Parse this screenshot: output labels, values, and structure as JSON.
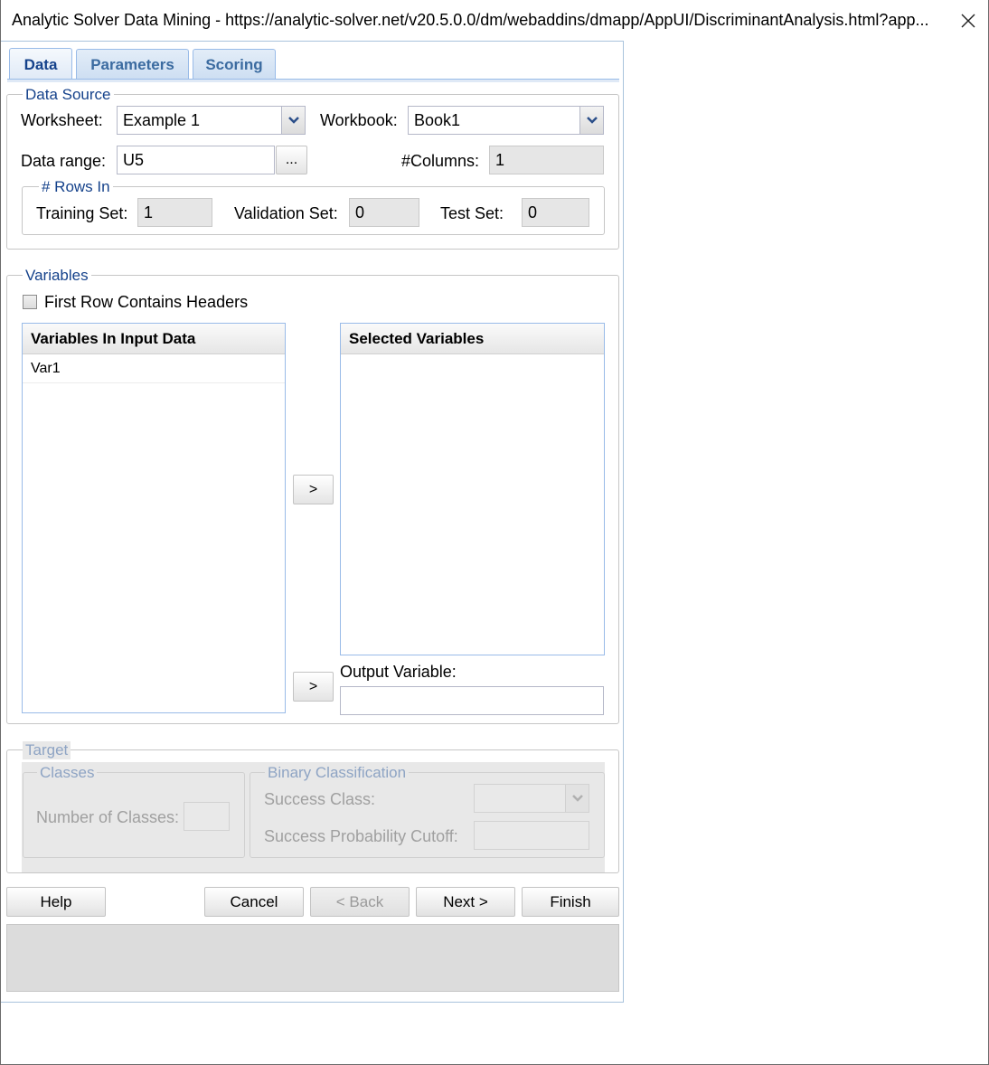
{
  "window": {
    "title": "Analytic Solver Data Mining - https://analytic-solver.net/v20.5.0.0/dm/webaddins/dmapp/AppUI/DiscriminantAnalysis.html?app..."
  },
  "tabs": [
    "Data",
    "Parameters",
    "Scoring"
  ],
  "data_source": {
    "legend": "Data Source",
    "worksheet_label": "Worksheet:",
    "worksheet_value": "Example 1",
    "workbook_label": "Workbook:",
    "workbook_value": "Book1",
    "data_range_label": "Data range:",
    "data_range_value": "U5",
    "range_button": "...",
    "columns_label": "#Columns:",
    "columns_value": "1",
    "rows_in": {
      "legend": "# Rows In",
      "training_label": "Training Set:",
      "training_value": "1",
      "validation_label": "Validation Set:",
      "validation_value": "0",
      "test_label": "Test Set:",
      "test_value": "0"
    }
  },
  "variables": {
    "legend": "Variables",
    "headers_checkbox_label": "First Row Contains Headers",
    "headers_checked": false,
    "input_header": "Variables In Input Data",
    "input_items": [
      "Var1"
    ],
    "selected_header": "Selected Variables",
    "selected_items": [],
    "move_selected_button": ">",
    "move_output_button": ">",
    "output_label": "Output Variable:",
    "output_value": ""
  },
  "target": {
    "legend": "Target",
    "classes_legend": "Classes",
    "num_classes_label": "Number of Classes:",
    "num_classes_value": "",
    "binary_legend": "Binary Classification",
    "success_class_label": "Success Class:",
    "success_class_value": "",
    "cutoff_label": "Success Probability Cutoff:",
    "cutoff_value": ""
  },
  "buttons": {
    "help": "Help",
    "cancel": "Cancel",
    "back": "< Back",
    "next": "Next >",
    "finish": "Finish"
  },
  "icons": {
    "close": "close-icon",
    "dropdown": "chevron-down-icon"
  },
  "colors": {
    "accent": "#15428b",
    "tab_border": "#99bbe8"
  }
}
